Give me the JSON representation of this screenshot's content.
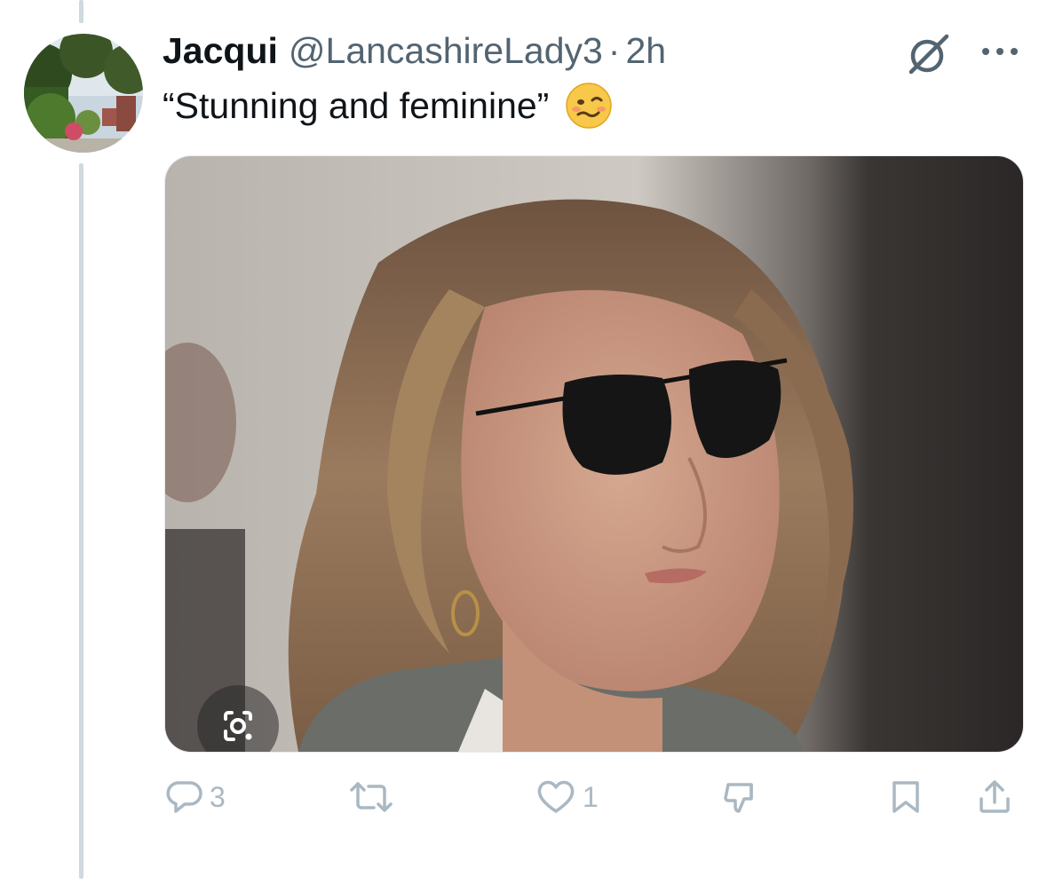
{
  "tweet": {
    "display_name": "Jacqui",
    "handle": "@LancashireLady3",
    "separator": "·",
    "time": "2h",
    "text": "“Stunning and feminine”",
    "emoji": "woozy-face-emoji",
    "media": {
      "description_icon": "camera-lens-icon"
    }
  },
  "actions": {
    "reply_count": "3",
    "retweet_count": "",
    "like_count": "1"
  },
  "icons": {
    "grok": "grok-icon",
    "more": "more-icon",
    "reply": "reply-icon",
    "retweet": "retweet-icon",
    "like": "heart-icon",
    "dislike": "dislike-icon",
    "bookmark": "bookmark-icon",
    "share": "share-icon"
  },
  "colors": {
    "text_primary": "#0f1419",
    "text_secondary": "#536471",
    "action_gray": "#aab8c2",
    "thread_line": "#cfd9de"
  }
}
